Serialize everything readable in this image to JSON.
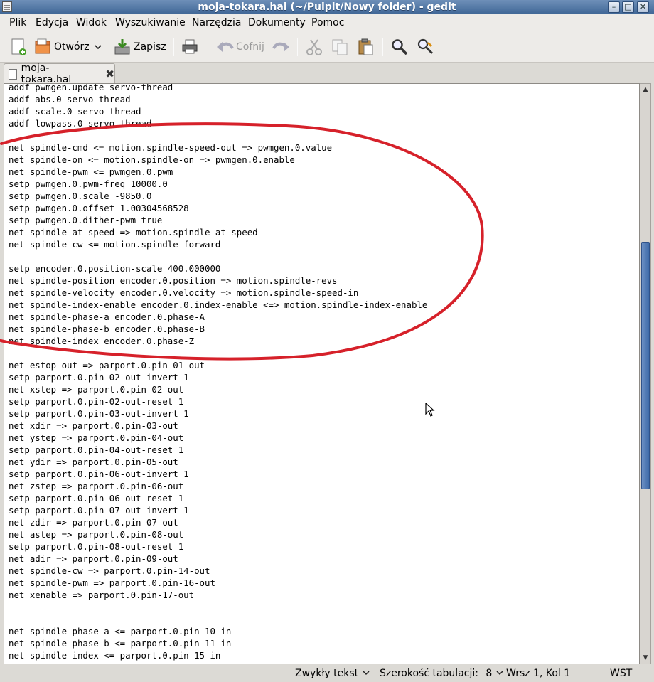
{
  "window": {
    "title": "moja-tokara.hal (~/Pulpit/Nowy folder) - gedit",
    "controls": {
      "minimize": "–",
      "maximize": "□",
      "close": "✕"
    }
  },
  "menu": [
    {
      "label": "Plik"
    },
    {
      "label": "Edycja"
    },
    {
      "label": "Widok"
    },
    {
      "label": "Wyszukiwanie"
    },
    {
      "label": "Narzędzia"
    },
    {
      "label": "Dokumenty"
    },
    {
      "label": "Pomoc"
    }
  ],
  "toolbar": {
    "new_icon": "new-document-icon",
    "open_label": "Otwórz",
    "save_label": "Zapisz",
    "undo_label": "Cofnij",
    "icons": [
      "new-document-icon",
      "open-folder-icon",
      "save-icon",
      "print-icon",
      "undo-icon",
      "redo-icon",
      "cut-icon",
      "copy-icon",
      "paste-icon",
      "search-icon",
      "replace-icon"
    ]
  },
  "tab": {
    "label": "moja-tokara.hal",
    "close": "✖"
  },
  "editor": {
    "lines": [
      "addf pwmgen.update servo-thread",
      "addf abs.0 servo-thread",
      "addf scale.0 servo-thread",
      "addf lowpass.0 servo-thread",
      "",
      "net spindle-cmd <= motion.spindle-speed-out => pwmgen.0.value",
      "net spindle-on <= motion.spindle-on => pwmgen.0.enable",
      "net spindle-pwm <= pwmgen.0.pwm",
      "setp pwmgen.0.pwm-freq 10000.0",
      "setp pwmgen.0.scale -9850.0",
      "setp pwmgen.0.offset 1.00304568528",
      "setp pwmgen.0.dither-pwm true",
      "net spindle-at-speed => motion.spindle-at-speed",
      "net spindle-cw <= motion.spindle-forward",
      "",
      "setp encoder.0.position-scale 400.000000",
      "net spindle-position encoder.0.position => motion.spindle-revs",
      "net spindle-velocity encoder.0.velocity => motion.spindle-speed-in",
      "net spindle-index-enable encoder.0.index-enable <=> motion.spindle-index-enable",
      "net spindle-phase-a encoder.0.phase-A",
      "net spindle-phase-b encoder.0.phase-B",
      "net spindle-index encoder.0.phase-Z",
      "",
      "net estop-out => parport.0.pin-01-out",
      "setp parport.0.pin-02-out-invert 1",
      "net xstep => parport.0.pin-02-out",
      "setp parport.0.pin-02-out-reset 1",
      "setp parport.0.pin-03-out-invert 1",
      "net xdir => parport.0.pin-03-out",
      "net ystep => parport.0.pin-04-out",
      "setp parport.0.pin-04-out-reset 1",
      "net ydir => parport.0.pin-05-out",
      "setp parport.0.pin-06-out-invert 1",
      "net zstep => parport.0.pin-06-out",
      "setp parport.0.pin-06-out-reset 1",
      "setp parport.0.pin-07-out-invert 1",
      "net zdir => parport.0.pin-07-out",
      "net astep => parport.0.pin-08-out",
      "setp parport.0.pin-08-out-reset 1",
      "net adir => parport.0.pin-09-out",
      "net spindle-cw => parport.0.pin-14-out",
      "net spindle-pwm => parport.0.pin-16-out",
      "net xenable => parport.0.pin-17-out",
      "",
      "",
      "net spindle-phase-a <= parport.0.pin-10-in",
      "net spindle-phase-b <= parport.0.pin-11-in",
      "net spindle-index <= parport.0.pin-15-in"
    ]
  },
  "statusbar": {
    "syntax": "Zwykły tekst",
    "tab_width": "Szerokość tabulacji:",
    "tab_width_value": "8",
    "position": "Wrsz 1, Kol 1",
    "mode": "WST"
  },
  "colors": {
    "annotation_ring": "#d6212a",
    "titlebar": "#3f6696",
    "scroll_thumb": "#3e6aa8"
  }
}
